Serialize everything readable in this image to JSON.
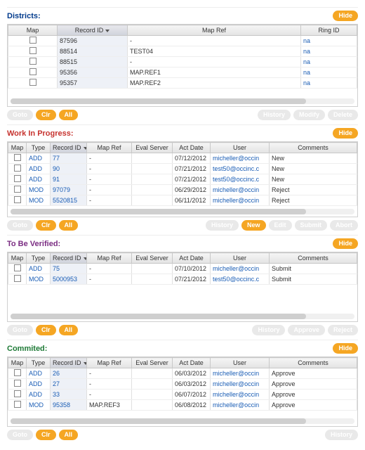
{
  "common": {
    "hide": "Hide",
    "goto": "Goto",
    "clr": "Clr",
    "all": "All",
    "history": "History",
    "modify": "Modify",
    "delete": "Delete",
    "new": "New",
    "edit": "Edit",
    "submit": "Submit",
    "abort": "Abort",
    "approve": "Approve",
    "reject": "Reject"
  },
  "districts": {
    "title": "Districts:",
    "cols": {
      "map": "Map",
      "record_id": "Record ID",
      "map_ref": "Map Ref",
      "ring_id": "Ring ID"
    },
    "rows": [
      {
        "id": "87596",
        "map_ref": "-",
        "ring": "na"
      },
      {
        "id": "88514",
        "map_ref": "TEST04",
        "ring": "na"
      },
      {
        "id": "88515",
        "map_ref": "-",
        "ring": "na"
      },
      {
        "id": "95356",
        "map_ref": "MAP.REF1",
        "ring": "na"
      },
      {
        "id": "95357",
        "map_ref": "MAP.REF2",
        "ring": "na"
      }
    ]
  },
  "wip": {
    "title": "Work In Progress:",
    "cols": {
      "map": "Map",
      "type": "Type",
      "record_id": "Record ID",
      "map_ref": "Map Ref",
      "eval": "Eval Server",
      "act": "Act Date",
      "user": "User",
      "comments": "Comments"
    },
    "rows": [
      {
        "type": "ADD",
        "id": "77",
        "map_ref": "-",
        "act": "07/12/2012",
        "user": "micheller@occin",
        "c": "New"
      },
      {
        "type": "ADD",
        "id": "90",
        "map_ref": "-",
        "act": "07/21/2012",
        "user": "test50@occinc.c",
        "c": "New"
      },
      {
        "type": "ADD",
        "id": "91",
        "map_ref": "-",
        "act": "07/21/2012",
        "user": "test50@occinc.c",
        "c": "New"
      },
      {
        "type": "MOD",
        "id": "97079",
        "map_ref": "-",
        "act": "06/29/2012",
        "user": "micheller@occin",
        "c": "Reject"
      },
      {
        "type": "MOD",
        "id": "5520815",
        "map_ref": "-",
        "act": "06/11/2012",
        "user": "micheller@occin",
        "c": "Reject"
      }
    ]
  },
  "tbv": {
    "title": "To Be Verified:",
    "rows": [
      {
        "type": "ADD",
        "id": "75",
        "map_ref": "-",
        "act": "07/10/2012",
        "user": "micheller@occin",
        "c": "Submit"
      },
      {
        "type": "MOD",
        "id": "5000953",
        "map_ref": "-",
        "act": "07/21/2012",
        "user": "test50@occinc.c",
        "c": "Submit"
      }
    ]
  },
  "commit": {
    "title": "Commited:",
    "rows": [
      {
        "type": "ADD",
        "id": "26",
        "map_ref": "-",
        "act": "06/03/2012",
        "user": "micheller@occin",
        "c": "Approve"
      },
      {
        "type": "ADD",
        "id": "27",
        "map_ref": "-",
        "act": "06/03/2012",
        "user": "micheller@occin",
        "c": "Approve"
      },
      {
        "type": "ADD",
        "id": "33",
        "map_ref": "-",
        "act": "06/07/2012",
        "user": "micheller@occin",
        "c": "Approve"
      },
      {
        "type": "MOD",
        "id": "95358",
        "map_ref": "MAP.REF3",
        "act": "06/08/2012",
        "user": "micheller@occin",
        "c": "Approve"
      }
    ]
  }
}
